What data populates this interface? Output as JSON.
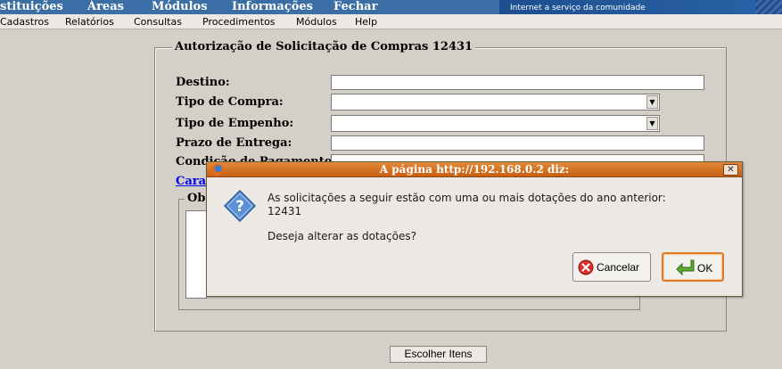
{
  "top_nav": {
    "items": [
      "stituições",
      "Áreas",
      "Módulos",
      "Informações",
      "Fechar"
    ],
    "brand_tagline": "Internet a serviço da comunidade"
  },
  "menu": {
    "items": [
      "Cadastros",
      "Relatórios",
      "Consultas",
      "Procedimentos",
      "Módulos",
      "Help"
    ]
  },
  "form": {
    "legend": "Autorização de Solicitação de Compras 12431",
    "destino_label": "Destino:",
    "destino_value": "",
    "tipo_compra_label": "Tipo de Compra:",
    "tipo_compra_value": "",
    "tipo_empenho_label": "Tipo de Empenho:",
    "tipo_empenho_value": "",
    "prazo_label": "Prazo de Entrega:",
    "prazo_value": "",
    "condicao_label": "Condição de Pagamento",
    "condicao_value": "",
    "link_text": "Carac",
    "obs_legend": "Obs",
    "choose_button": "Escolher Itens"
  },
  "dialog": {
    "title": "A página http://192.168.0.2 diz:",
    "message_line1": "As solicitações a seguir estão com uma ou mais dotações do ano anterior:",
    "message_line2": "12431",
    "message_line3": "Deseja alterar as dotações?",
    "cancel_label": "Cancelar",
    "ok_label": "OK",
    "close_glyph": "✕"
  },
  "colors": {
    "accent": "#c85f12",
    "background": "#d4d0c8"
  }
}
